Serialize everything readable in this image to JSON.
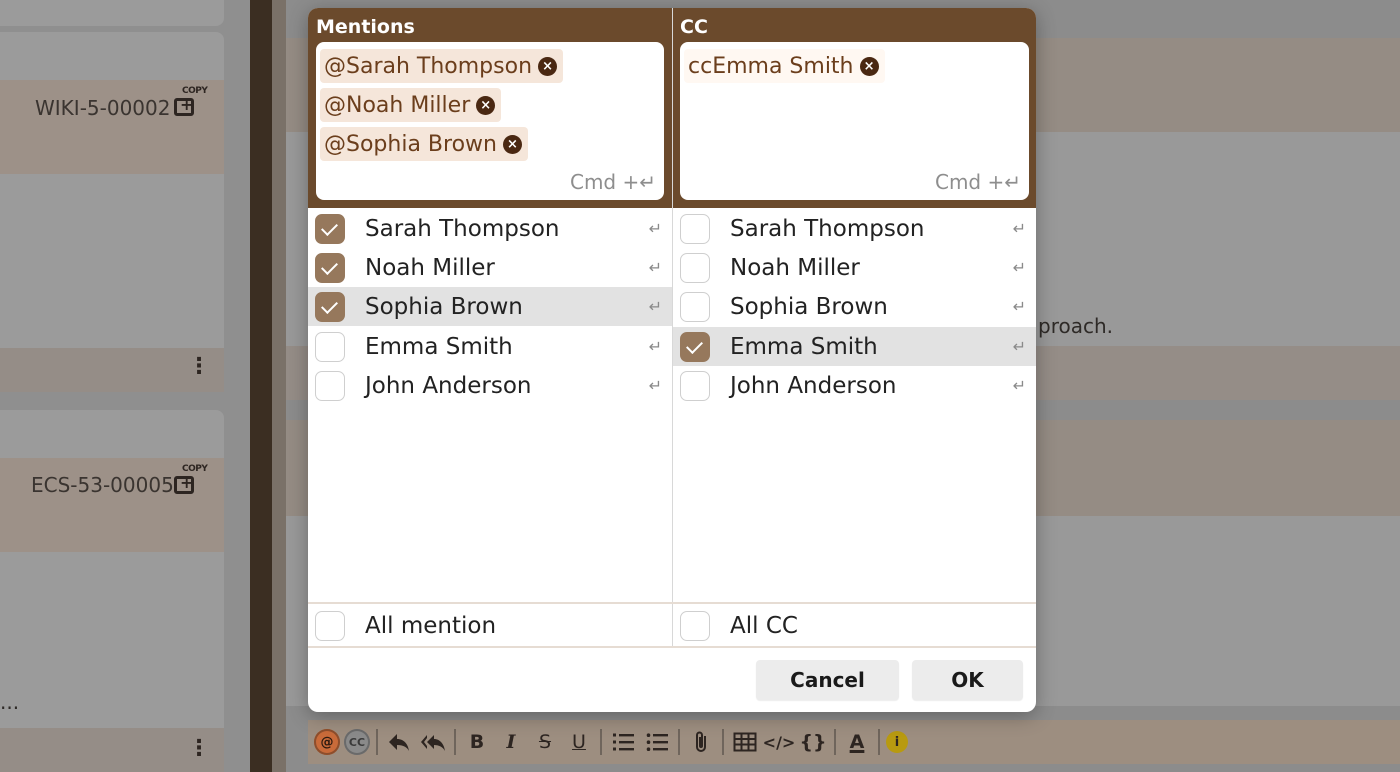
{
  "background": {
    "cards": [
      {
        "id": "WIKI-5-00002",
        "copy_label": "COPY"
      },
      {
        "id": "ECS-53-00005",
        "copy_label": "COPY"
      }
    ],
    "kebab": "⋮",
    "ellipsis": "...",
    "right_text": "proach."
  },
  "dialog": {
    "mentions": {
      "title": "Mentions",
      "tags": [
        "@Sarah Thompson",
        "@Noah Miller",
        "@Sophia Brown"
      ],
      "hint": "Cmd +↵",
      "items": [
        {
          "label": "Sarah Thompson",
          "checked": true
        },
        {
          "label": "Noah Miller",
          "checked": true
        },
        {
          "label": "Sophia Brown",
          "checked": true
        },
        {
          "label": "Emma Smith",
          "checked": false
        },
        {
          "label": "John Anderson",
          "checked": false
        }
      ],
      "all_label": "All mention"
    },
    "cc": {
      "title": "CC",
      "tags": [
        "ccEmma Smith"
      ],
      "hint": "Cmd +↵",
      "items": [
        {
          "label": "Sarah Thompson",
          "checked": false
        },
        {
          "label": "Noah Miller",
          "checked": false
        },
        {
          "label": "Sophia Brown",
          "checked": false
        },
        {
          "label": "Emma Smith",
          "checked": true
        },
        {
          "label": "John Anderson",
          "checked": false
        }
      ],
      "all_label": "All CC"
    },
    "enter_glyph": "↵",
    "tag_remove_glyph": "×",
    "cancel_label": "Cancel",
    "ok_label": "OK"
  },
  "toolbar": {
    "mention": "@",
    "cc": "CC",
    "bold": "B",
    "italic": "I",
    "strike": "S",
    "underline": "U",
    "code": "</>",
    "braces": "{}",
    "font_color": "A",
    "info": "i"
  },
  "colors": {
    "brand_brown": "#6b4a2c",
    "check_on": "#96785c",
    "tag_bg": "#f5e6da"
  }
}
